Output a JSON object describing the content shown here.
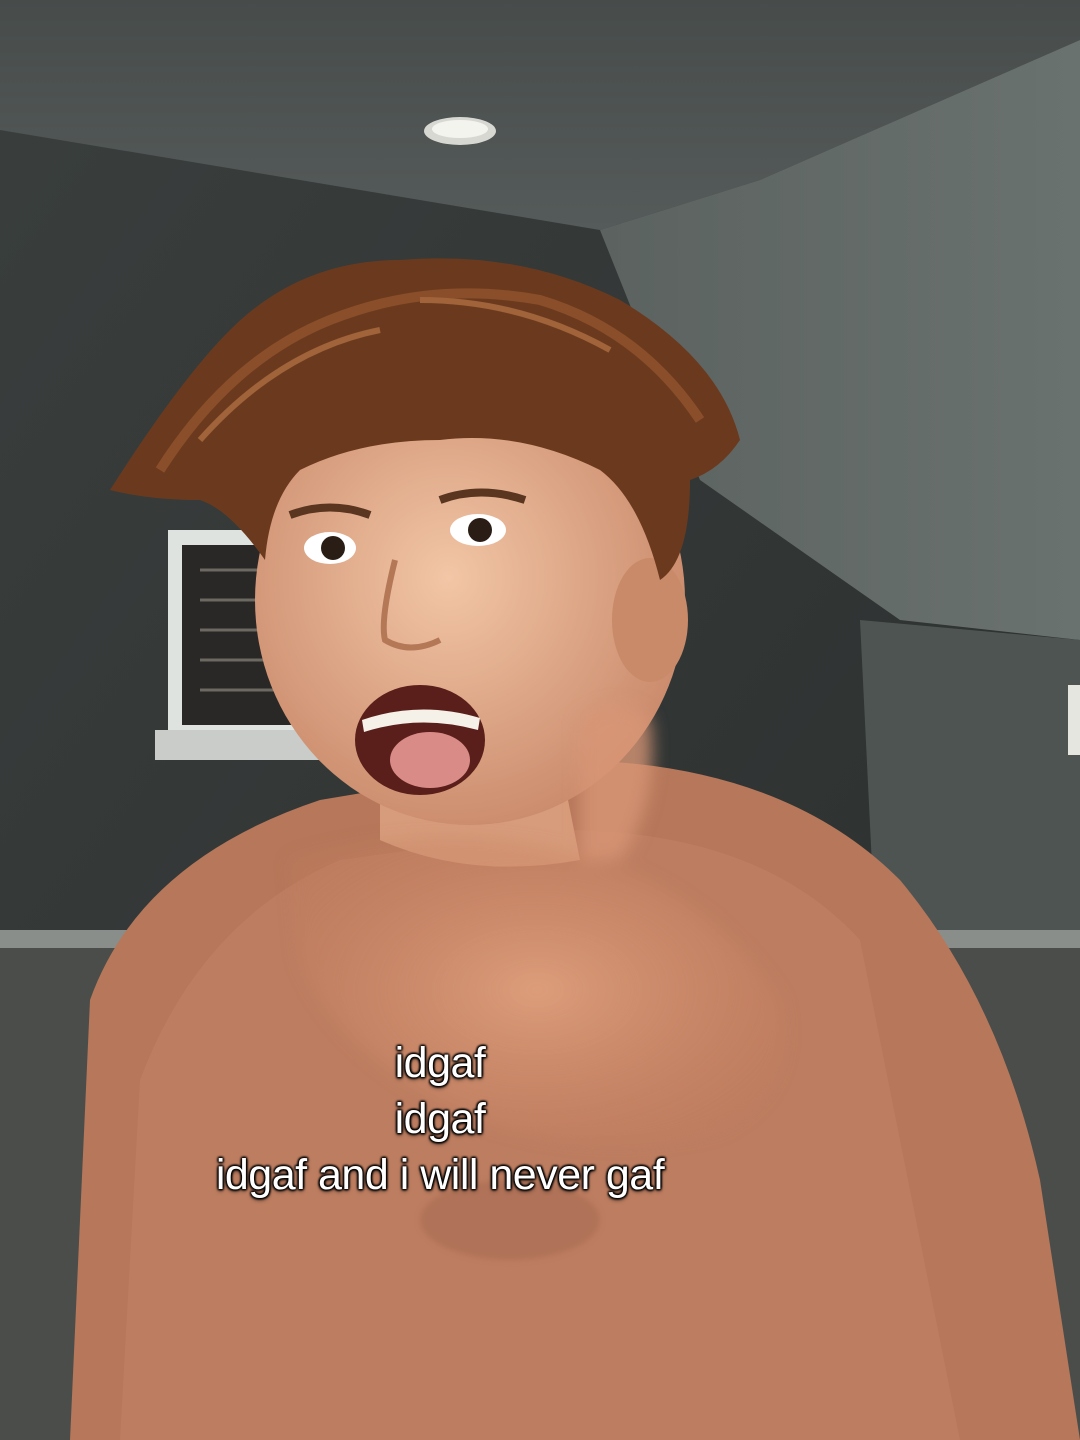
{
  "caption": {
    "lines": [
      "idgaf",
      "idgaf",
      "idgaf and i will never gaf"
    ]
  },
  "colors": {
    "wall": "#3f4543",
    "ceiling": "#4a4f4e",
    "shirt": "#b8785a",
    "hair": "#6b3a1e",
    "skin": "#e3b08f"
  }
}
